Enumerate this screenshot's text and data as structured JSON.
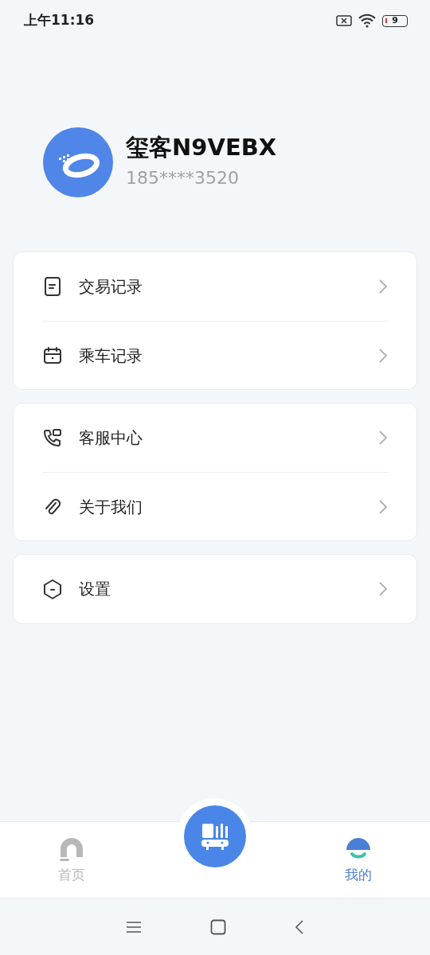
{
  "status_bar": {
    "time": "上午11:16",
    "battery": "9"
  },
  "profile": {
    "name": "玺客N9VEBX",
    "phone": "185****3520"
  },
  "menu_groups": [
    {
      "items": [
        {
          "kind": "receipt",
          "label": "交易记录"
        },
        {
          "kind": "calendar",
          "label": "乘车记录"
        }
      ]
    },
    {
      "items": [
        {
          "kind": "phone",
          "label": "客服中心"
        },
        {
          "kind": "link",
          "label": "关于我们"
        }
      ]
    },
    {
      "items": [
        {
          "kind": "settings",
          "label": "设置"
        }
      ]
    }
  ],
  "tabs": [
    {
      "kind": "home",
      "label": "首页",
      "selected": false
    },
    {
      "kind": "me",
      "label": "我的",
      "selected": true
    }
  ]
}
